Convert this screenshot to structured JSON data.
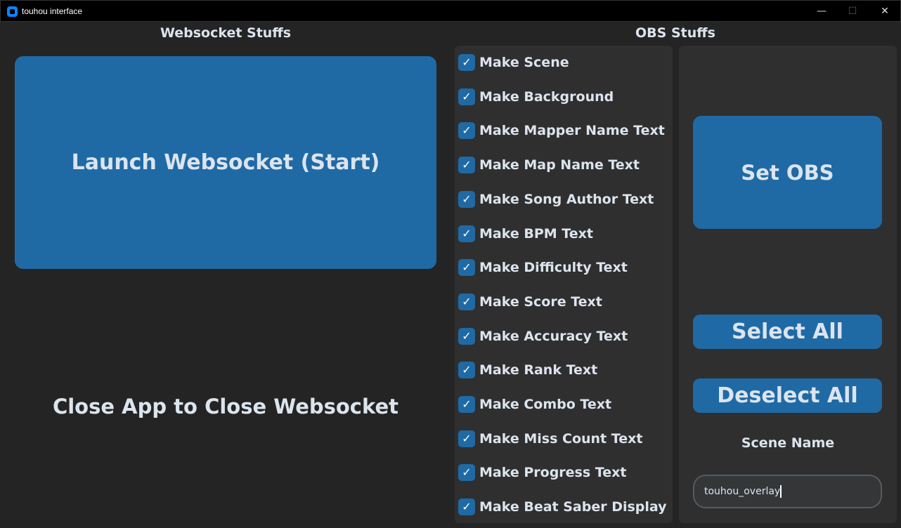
{
  "window": {
    "title": "touhou interface",
    "minimize": "—",
    "maximize": "☐",
    "close": "✕"
  },
  "websocket": {
    "heading": "Websocket Stuffs",
    "launch_label": "Launch Websocket (Start)",
    "note": "Close App to Close Websocket"
  },
  "obs": {
    "heading": "OBS Stuffs",
    "checkboxes": [
      {
        "label": "Make Scene",
        "checked": true
      },
      {
        "label": "Make Background",
        "checked": true
      },
      {
        "label": "Make Mapper Name Text",
        "checked": true
      },
      {
        "label": "Make Map Name Text",
        "checked": true
      },
      {
        "label": "Make Song Author Text",
        "checked": true
      },
      {
        "label": "Make BPM Text",
        "checked": true
      },
      {
        "label": "Make Difficulty Text",
        "checked": true
      },
      {
        "label": "Make Score Text",
        "checked": true
      },
      {
        "label": "Make Accuracy Text",
        "checked": true
      },
      {
        "label": "Make Rank Text",
        "checked": true
      },
      {
        "label": "Make Combo Text",
        "checked": true
      },
      {
        "label": "Make Miss Count Text",
        "checked": true
      },
      {
        "label": "Make Progress Text",
        "checked": true
      },
      {
        "label": "Make Beat Saber Display",
        "checked": true
      }
    ],
    "set_obs_label": "Set OBS",
    "select_all_label": "Select All",
    "deselect_all_label": "Deselect All",
    "scene_name_label": "Scene Name",
    "scene_name_value": "touhou_overlay"
  },
  "check_glyph": "✓"
}
